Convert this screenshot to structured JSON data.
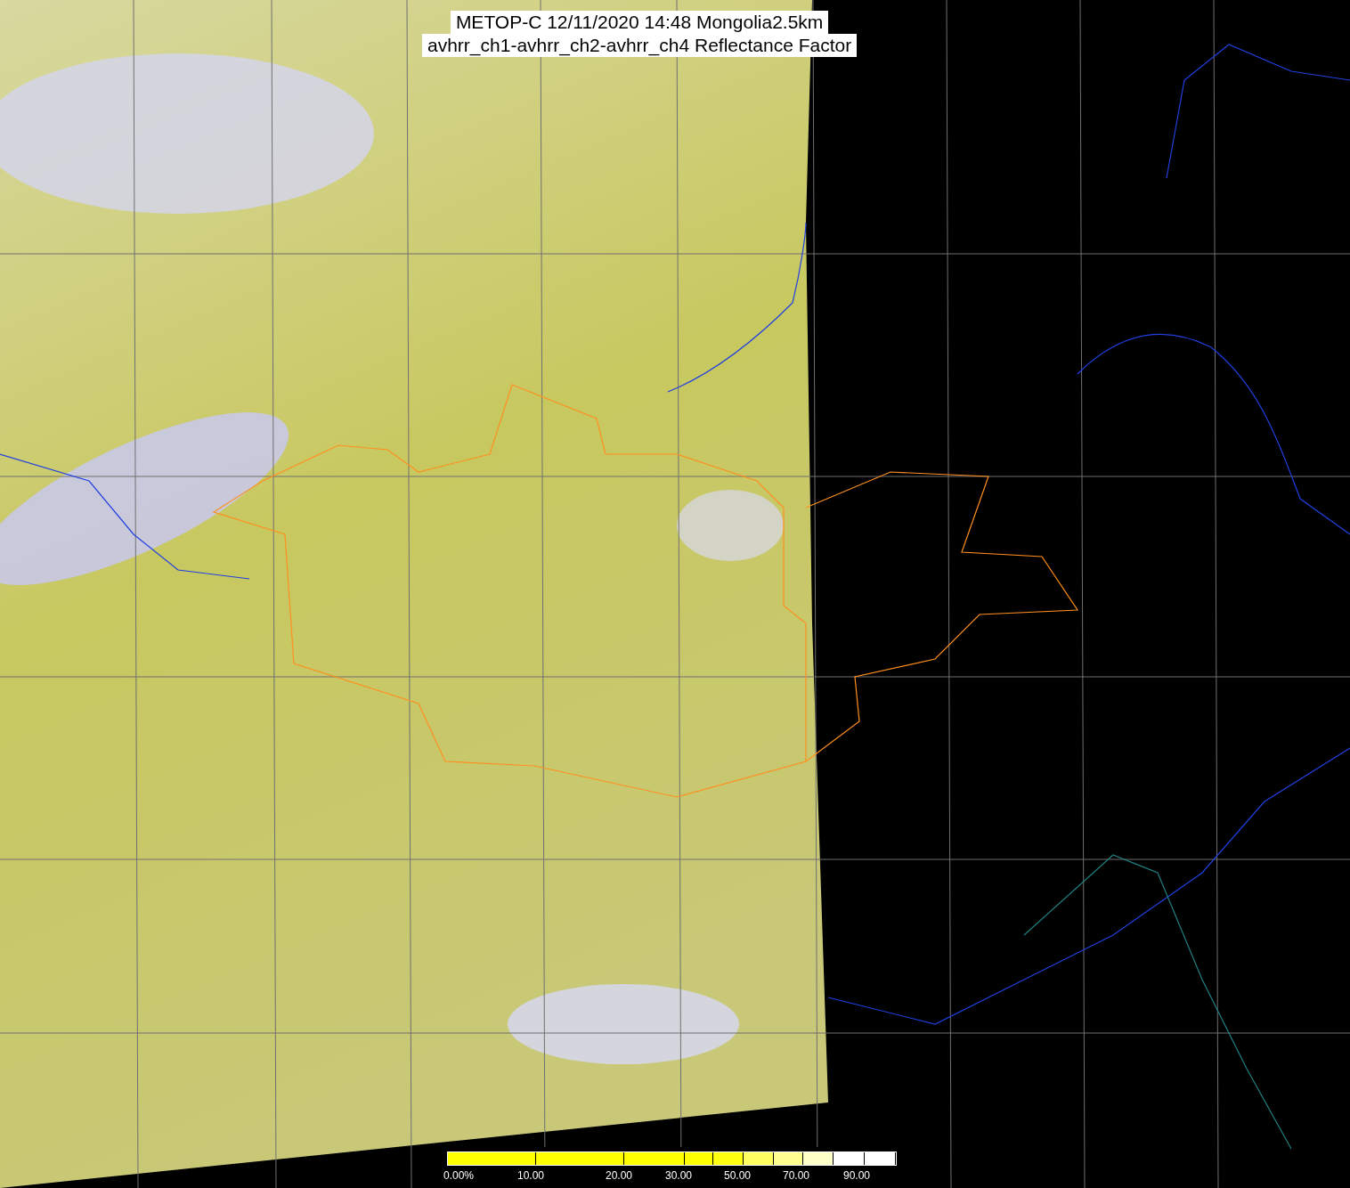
{
  "title_lines": [
    "METOP-C 12/11/2020 14:48 Mongolia2.5km",
    "avhrr_ch1-avhrr_ch2-avhrr_ch4 Reflectance Factor"
  ],
  "colorbar": {
    "segments": [
      {
        "color": "#ffff00"
      },
      {
        "color": "#ffff00"
      },
      {
        "color": "#ffff00"
      },
      {
        "color": "#ffff00"
      },
      {
        "color": "#ffff10"
      },
      {
        "color": "#ffff60"
      },
      {
        "color": "#ffff90"
      },
      {
        "color": "#ffffc8"
      },
      {
        "color": "#ffffff"
      },
      {
        "color": "#ffffff"
      }
    ],
    "labels": [
      "0.00%",
      "10.00",
      "20.00",
      "30.00",
      "50.00",
      "70.00",
      "90.00"
    ]
  }
}
